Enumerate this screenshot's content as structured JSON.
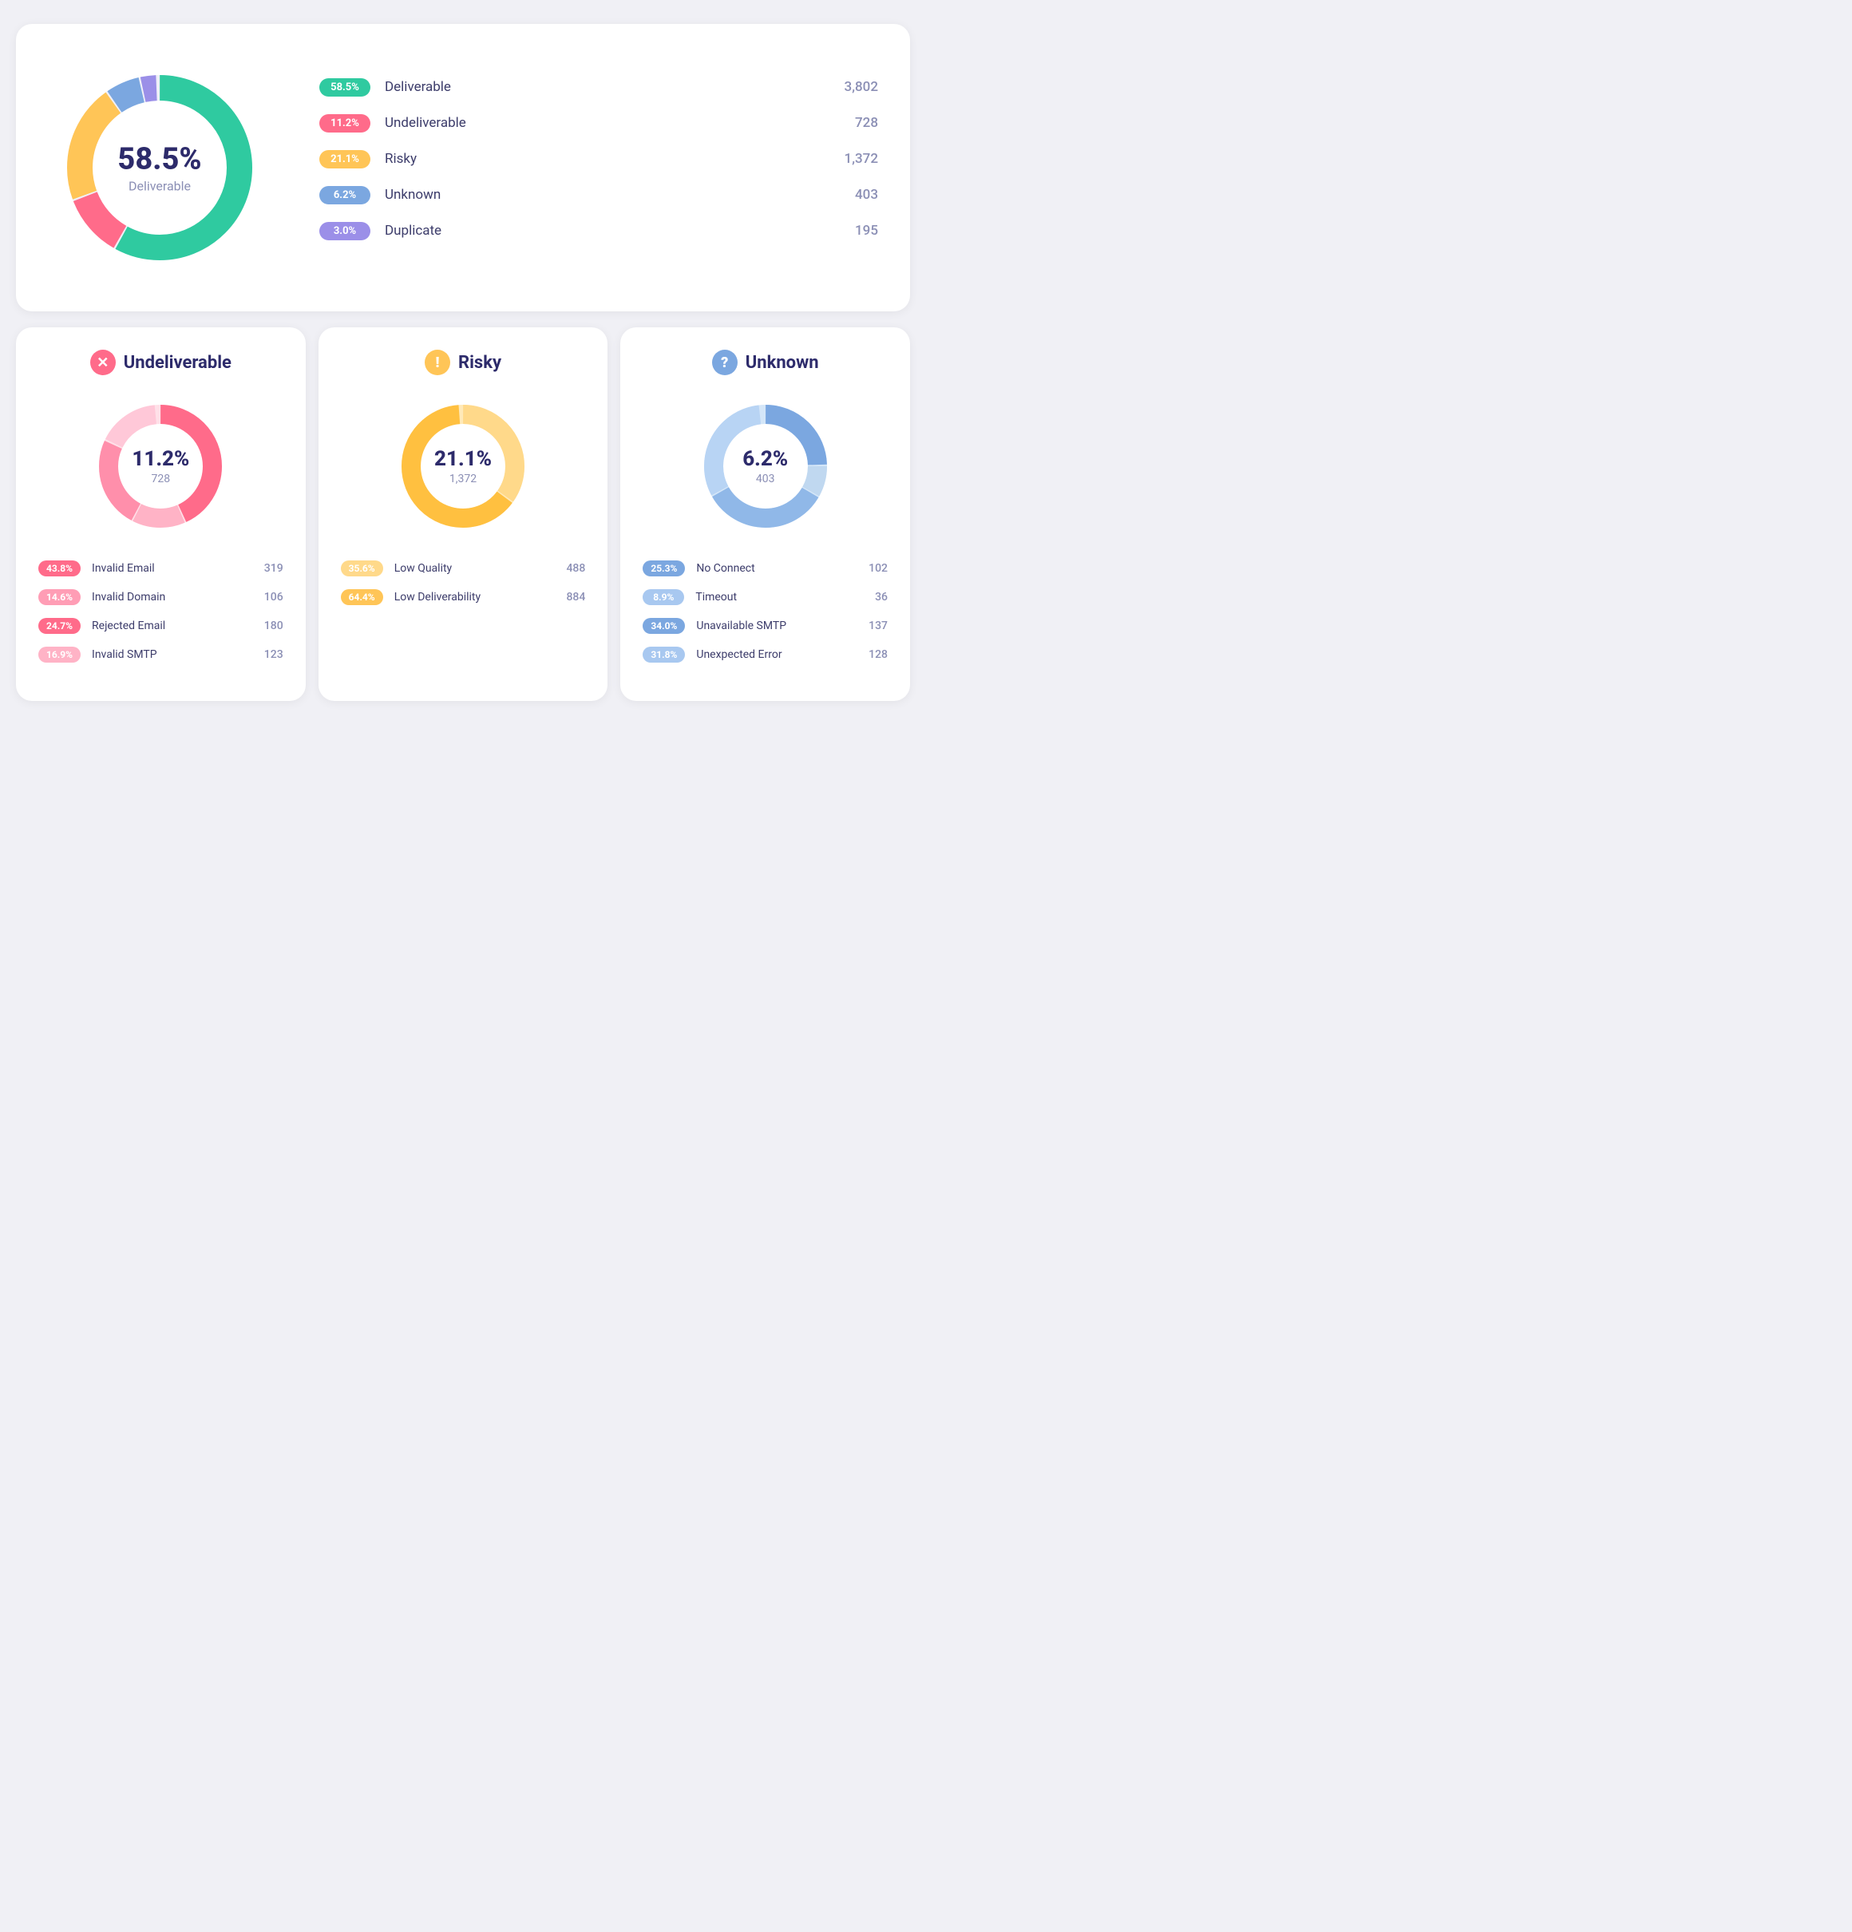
{
  "top": {
    "center_pct": "58.5%",
    "center_label": "Deliverable",
    "legend": [
      {
        "badge_text": "58.5%",
        "color": "#2fcaa0",
        "name": "Deliverable",
        "count": "3,802"
      },
      {
        "badge_text": "11.2%",
        "color": "#ff6b8a",
        "name": "Undeliverable",
        "count": "728"
      },
      {
        "badge_text": "21.1%",
        "color": "#ffc557",
        "name": "Risky",
        "count": "1,372"
      },
      {
        "badge_text": "6.2%",
        "color": "#7ba7e0",
        "name": "Unknown",
        "count": "403"
      },
      {
        "badge_text": "3.0%",
        "color": "#9b8fe8",
        "name": "Duplicate",
        "count": "195"
      }
    ]
  },
  "undeliverable": {
    "title": "Undeliverable",
    "icon_char": "✕",
    "icon_color": "#ff6b8a",
    "pct": "11.2%",
    "count": "728",
    "items": [
      {
        "badge": "43.8%",
        "color": "#ff6b8a",
        "name": "Invalid Email",
        "count": "319"
      },
      {
        "badge": "14.6%",
        "color": "#ff9db5",
        "name": "Invalid Domain",
        "count": "106"
      },
      {
        "badge": "24.7%",
        "color": "#ff6b8a",
        "name": "Rejected Email",
        "count": "180"
      },
      {
        "badge": "16.9%",
        "color": "#ffb3c6",
        "name": "Invalid SMTP",
        "count": "123"
      }
    ]
  },
  "risky": {
    "title": "Risky",
    "icon_char": "!",
    "icon_color": "#ffc557",
    "pct": "21.1%",
    "count": "1,372",
    "items": [
      {
        "badge": "35.6%",
        "color": "#ffd98a",
        "name": "Low Quality",
        "count": "488"
      },
      {
        "badge": "64.4%",
        "color": "#ffc557",
        "name": "Low Deliverability",
        "count": "884"
      }
    ]
  },
  "unknown": {
    "title": "Unknown",
    "icon_char": "?",
    "icon_color": "#7ba7e0",
    "pct": "6.2%",
    "count": "403",
    "items": [
      {
        "badge": "25.3%",
        "color": "#7ba7e0",
        "name": "No Connect",
        "count": "102"
      },
      {
        "badge": "8.9%",
        "color": "#a8c8f0",
        "name": "Timeout",
        "count": "36"
      },
      {
        "badge": "34.0%",
        "color": "#7ba7e0",
        "name": "Unavailable SMTP",
        "count": "137"
      },
      {
        "badge": "31.8%",
        "color": "#a8c8f0",
        "name": "Unexpected Error",
        "count": "128"
      }
    ]
  }
}
